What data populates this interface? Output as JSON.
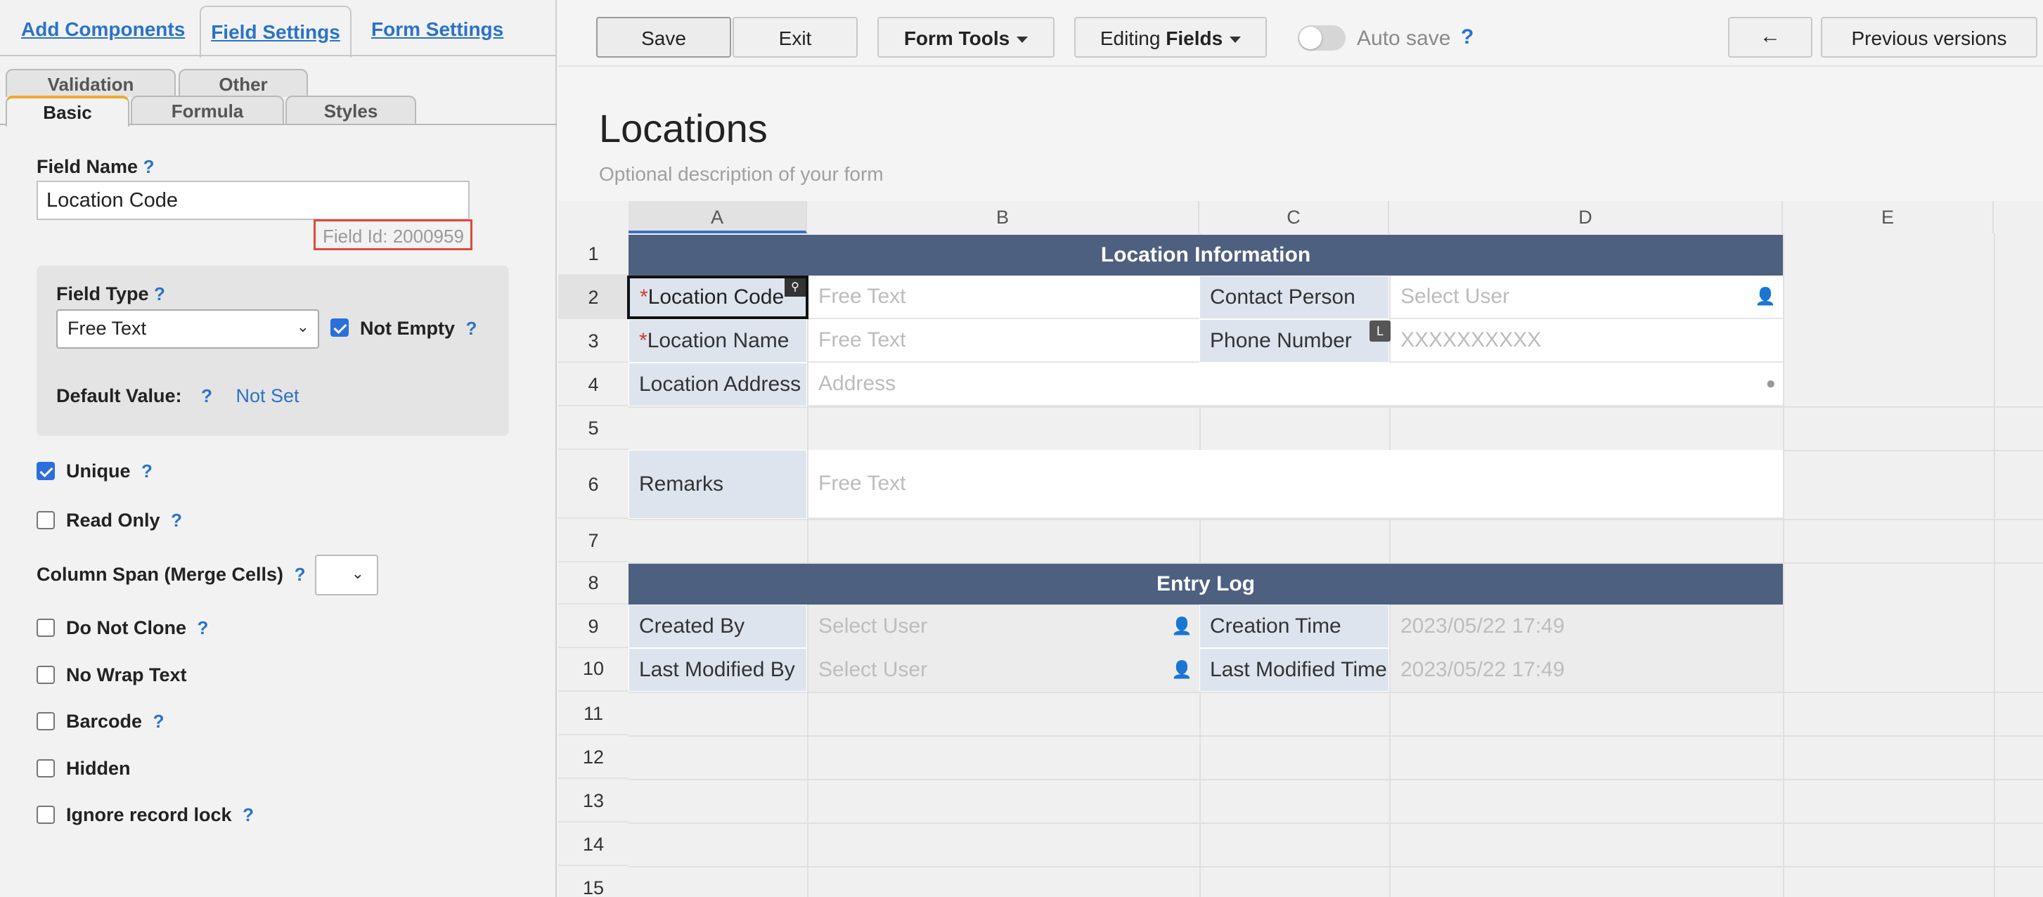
{
  "left_panel": {
    "tabs": {
      "add_components": "Add Components",
      "field_settings": "Field Settings",
      "form_settings": "Form Settings"
    },
    "subtabs": {
      "validation": "Validation",
      "other": "Other",
      "basic": "Basic",
      "formula": "Formula",
      "styles": "Styles"
    },
    "field_name_label": "Field Name",
    "field_name_value": "Location Code",
    "field_id": "Field Id: 2000959",
    "field_type_label": "Field Type",
    "field_type_value": "Free Text",
    "not_empty_label": "Not Empty",
    "not_empty_checked": true,
    "default_value_label": "Default Value:",
    "default_value": "Not Set",
    "help": "?",
    "options": [
      {
        "label": "Unique",
        "checked": true,
        "help": true
      },
      {
        "label": "Read Only",
        "checked": false,
        "help": true
      },
      {
        "label": "Do Not Clone",
        "checked": false,
        "help": true
      },
      {
        "label": "No Wrap Text",
        "checked": false,
        "help": false
      },
      {
        "label": "Barcode",
        "checked": false,
        "help": true
      },
      {
        "label": "Hidden",
        "checked": false,
        "help": false
      },
      {
        "label": "Ignore record lock",
        "checked": false,
        "help": true
      }
    ],
    "column_span_label": "Column Span (Merge Cells)",
    "column_span_value": ""
  },
  "toolbar": {
    "save": "Save",
    "exit": "Exit",
    "form_tools": "Form Tools",
    "editing_prefix": "Editing",
    "editing_bold": "Fields",
    "auto_save": "Auto save",
    "auto_save_on": false,
    "back_arrow": "←",
    "previous_versions": "Previous versions"
  },
  "form": {
    "title": "Locations",
    "description": "Optional description of your form"
  },
  "grid": {
    "columns": [
      "A",
      "B",
      "C",
      "D",
      "E"
    ],
    "rows": [
      "1",
      "2",
      "3",
      "4",
      "5",
      "6",
      "7",
      "8",
      "9",
      "10",
      "11",
      "12",
      "13",
      "14",
      "15"
    ],
    "cells": {
      "section1": "Location Information",
      "a2_req": "*",
      "a2": "Location Code",
      "b2": "Free Text",
      "c2": "Contact Person",
      "d2": "Select User",
      "a3_req": "*",
      "a3": "Location Name",
      "b3": "Free Text",
      "c3": "Phone Number",
      "c3_badge": "L",
      "d3": "XXXXXXXXXX",
      "a4": "Location Address",
      "b4": "Address",
      "a6": "Remarks",
      "b6": "Free Text",
      "section2": "Entry Log",
      "a9": "Created By",
      "b9": "Select User",
      "c9": "Creation Time",
      "d9": "2023/05/22 17:49",
      "a10": "Last Modified By",
      "b10": "Select User",
      "c10": "Last Modified Time",
      "d10": "2023/05/22 17:49"
    }
  },
  "colors": {
    "accent": "#2a73c8",
    "section_header": "#4d6080",
    "label_cell": "#dde4ee",
    "field_id_border": "#e04a3b",
    "required": "#d23b2b"
  }
}
